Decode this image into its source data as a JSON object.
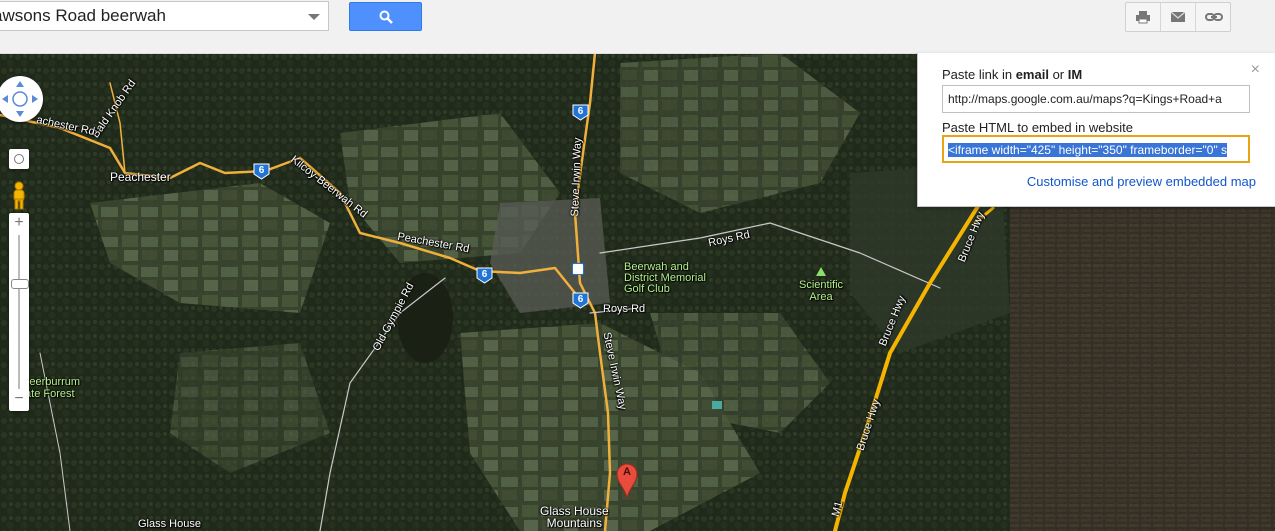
{
  "search": {
    "value": "awsons Road beerwah",
    "button_icon": "search-icon"
  },
  "toolbar": {
    "print_icon": "print-icon",
    "email_icon": "email-icon",
    "link_icon": "link-icon"
  },
  "share_popup": {
    "close_symbol": "×",
    "link_label_prefix": "Paste link in ",
    "link_label_email": "email",
    "link_label_or": " or ",
    "link_label_im": "IM",
    "link_value": "http://maps.google.com.au/maps?q=Kings+Road+a",
    "embed_label": "Paste HTML to embed in website",
    "embed_value": "<iframe width=\"425\" height=\"350\" frameborder=\"0\" s",
    "customise_link": "Customise and preview embedded map"
  },
  "map": {
    "labels": {
      "peachester": "Peachester",
      "bald_knob_rd": "Bald Knob Rd",
      "peachester_rd_nw": "achester Rd",
      "kilcoy_beerwah_rd": "Kilcoy-Beerwah Rd",
      "peachester_rd": "Peachester Rd",
      "old_gympie_rd": "Old Gympie Rd",
      "steve_irwin_way_n": "Steve Irwin Way",
      "steve_irwin_way_s": "Steve Irwin Way",
      "roys_rd_n": "Roys Rd",
      "roys_rd_s": "Roys Rd",
      "golf_club_line1": "Beerwah and",
      "golf_club_line2": "District Memorial",
      "golf_club_line3": "Golf Club",
      "scientific_line1": "Scientific",
      "scientific_line2": "Area",
      "beerburrum_line1": "Beerburrum",
      "beerburrum_line2": "tate Forest",
      "bruce_hwy_n": "Bruce Hwy",
      "bruce_hwy_mid": "Bruce Hwy",
      "bruce_hwy_s": "Bruce Hwy",
      "glass_house_mtns_line1": "Glass House",
      "glass_house_mtns_line2": "Mountains",
      "glass_house_sw": "Glass House",
      "m1": "M1"
    },
    "route_shield": "6",
    "marker_letter": "A",
    "colors": {
      "road": "#f0b03c",
      "highway": "#f4b400",
      "marker": "#e74c3c"
    }
  }
}
